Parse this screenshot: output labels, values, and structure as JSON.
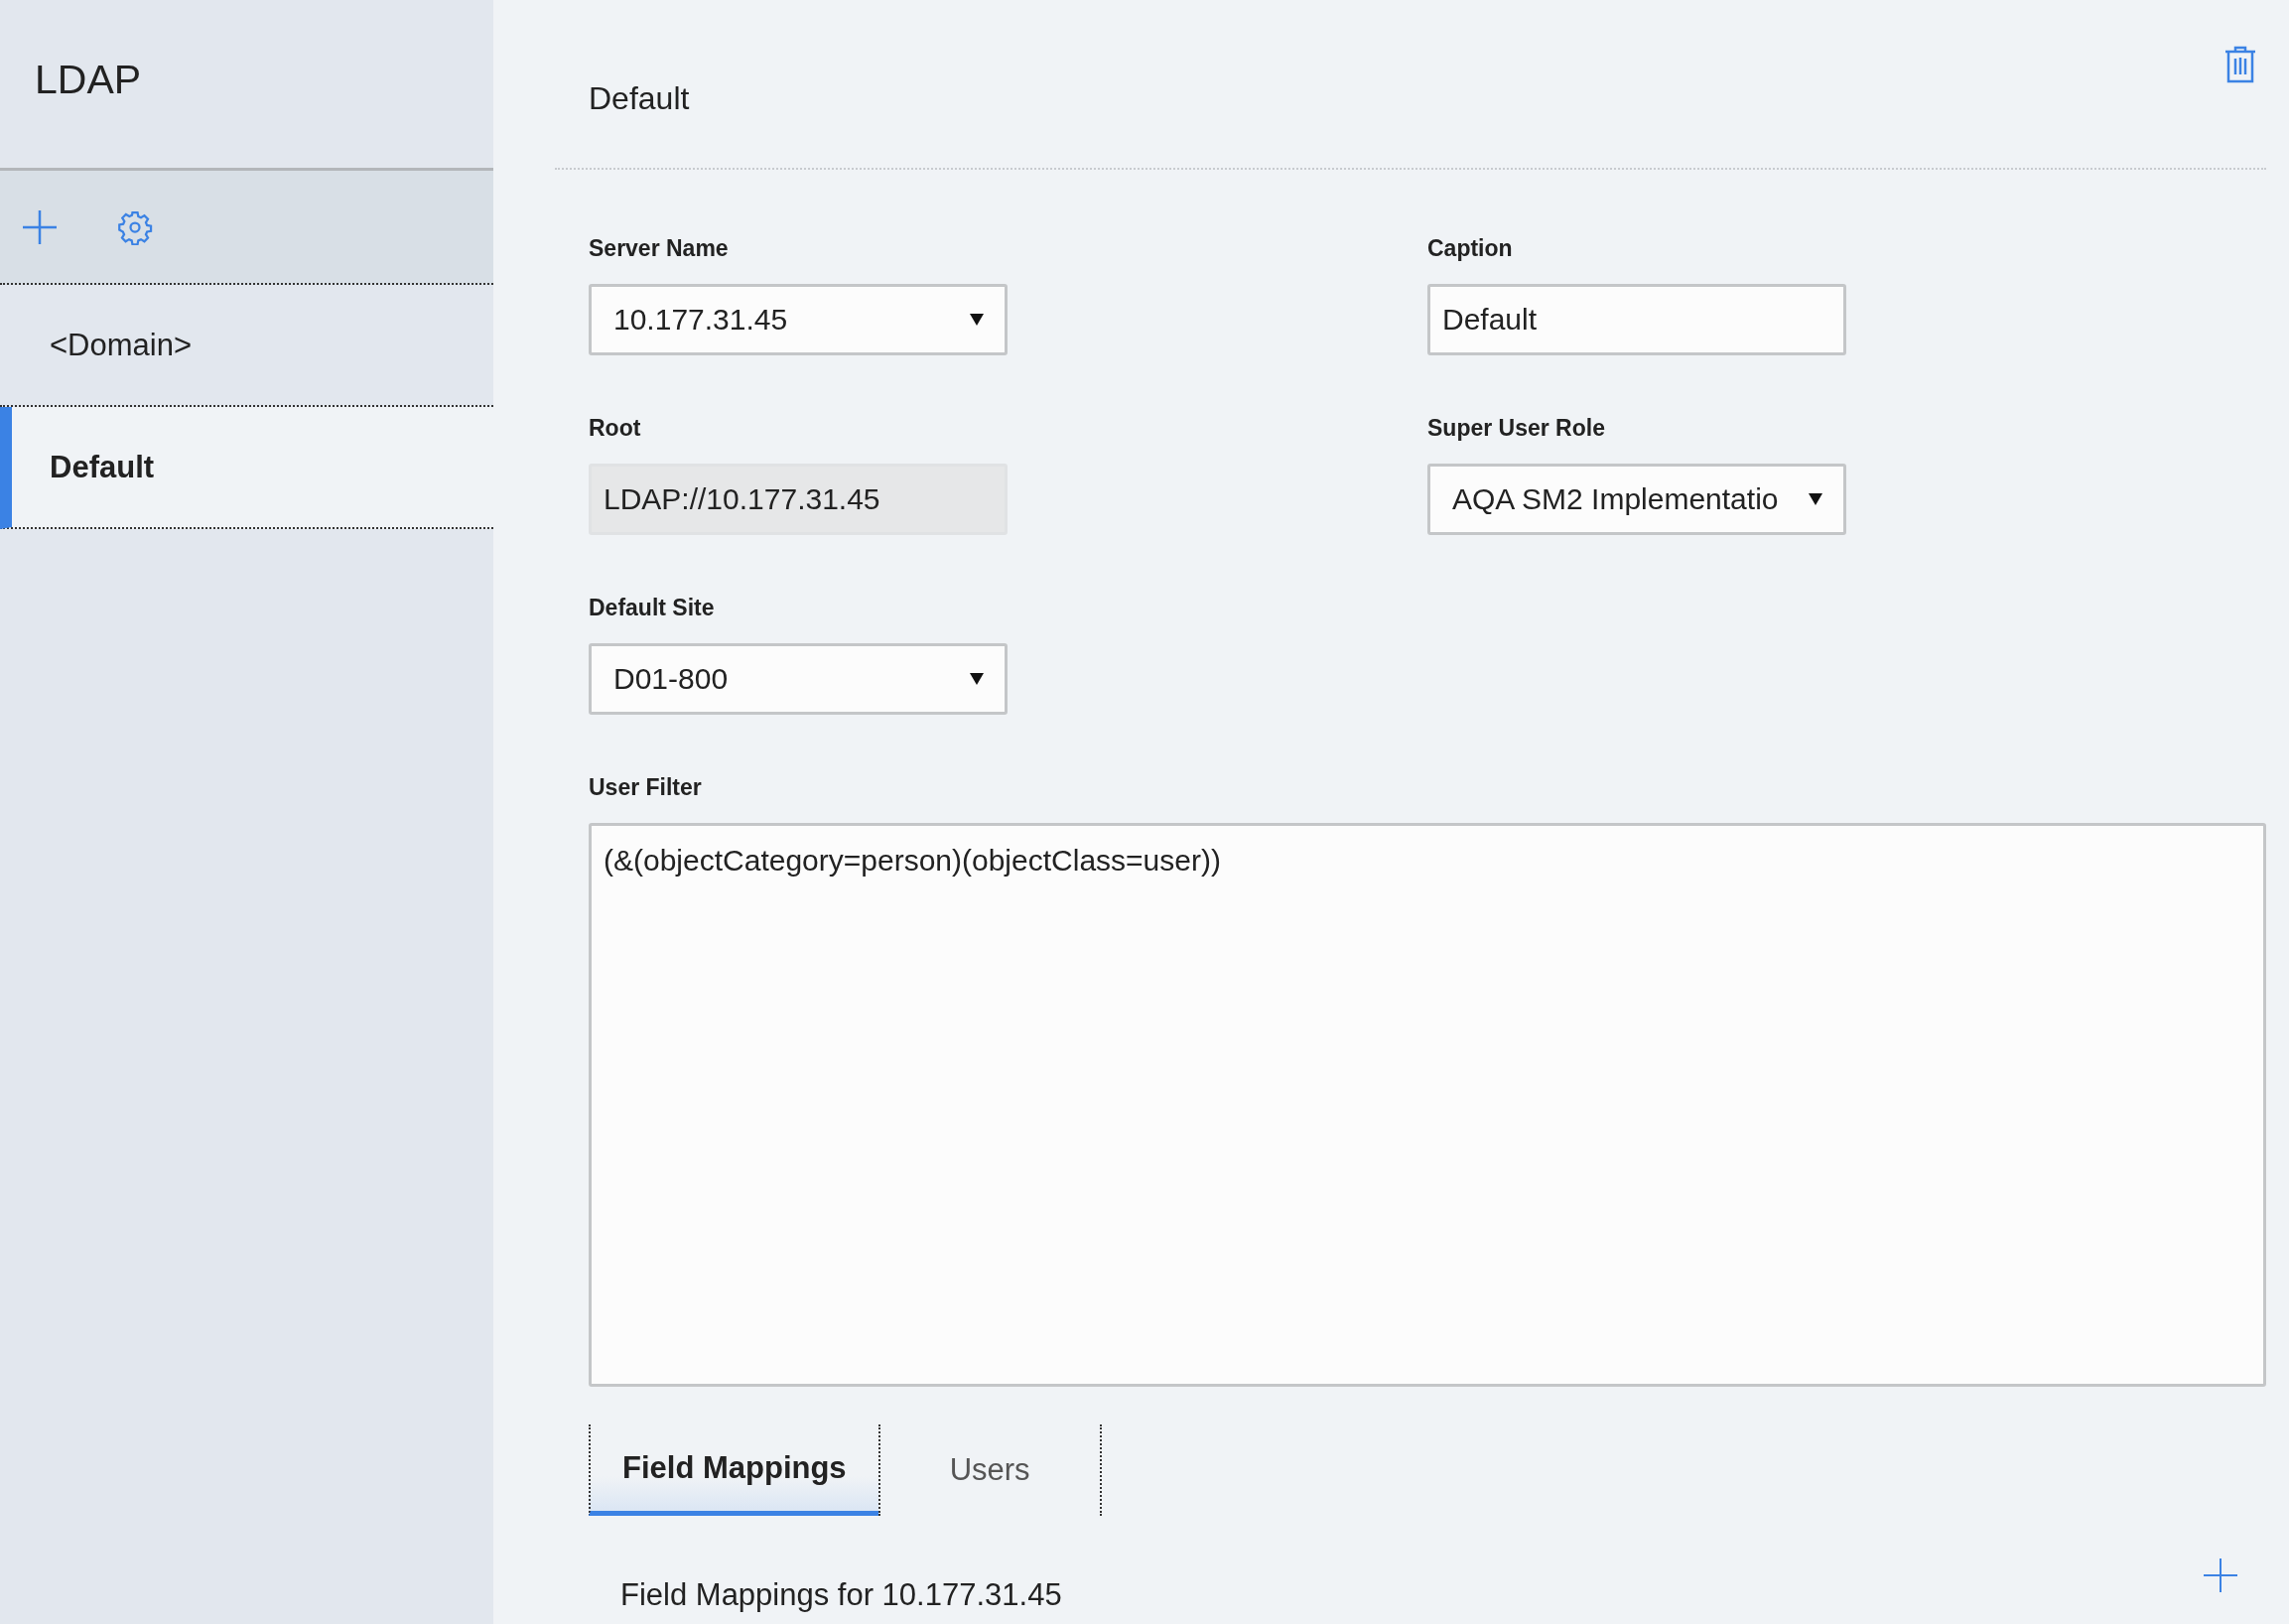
{
  "sidebar": {
    "title": "LDAP",
    "items": [
      {
        "label": "<Domain>",
        "selected": false
      },
      {
        "label": "Default",
        "selected": true
      }
    ]
  },
  "main": {
    "title": "Default",
    "left_fields": [
      {
        "kind": "select",
        "label": "Server Name",
        "value": "10.177.31.45"
      },
      {
        "kind": "readonly",
        "label": "Root",
        "value": "LDAP://10.177.31.45"
      },
      {
        "kind": "select",
        "label": "Default Site",
        "value": "D01-800"
      }
    ],
    "right_fields": [
      {
        "kind": "text",
        "label": "Caption",
        "value": "Default"
      },
      {
        "kind": "select",
        "label": "Super User Role",
        "value": "AQA SM2 Implementatio"
      }
    ],
    "user_filter": {
      "label": "User Filter",
      "value": "(&(objectCategory=person)(objectClass=user))"
    },
    "tabs": [
      {
        "label": "Field Mappings",
        "selected": true
      },
      {
        "label": "Users",
        "selected": false
      }
    ],
    "section_title": "Field Mappings for 10.177.31.45"
  }
}
